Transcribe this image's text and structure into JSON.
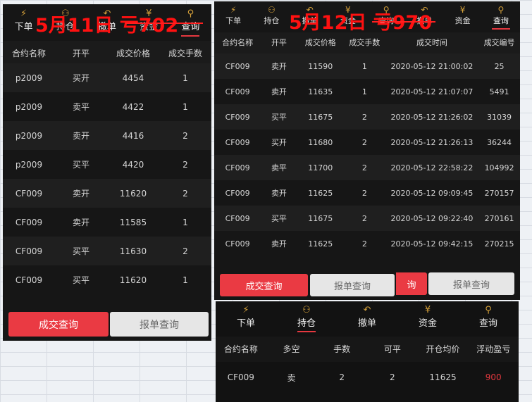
{
  "panel1": {
    "tabs": [
      {
        "icon": "lightning-icon",
        "glyph": "⚡",
        "label": "下单"
      },
      {
        "icon": "position-icon",
        "glyph": "⚇",
        "label": "持仓"
      },
      {
        "icon": "undo-arrow-icon",
        "glyph": "↶",
        "label": "撤单"
      },
      {
        "icon": "yen-coin-icon",
        "glyph": "¥",
        "label": "资金"
      },
      {
        "icon": "search-icon",
        "glyph": "⚲",
        "label": "查询"
      }
    ],
    "overlay": "5月11日 亏702",
    "headers": [
      "合约名称",
      "开平",
      "成交价格",
      "成交手数"
    ],
    "rows": [
      [
        "p2009",
        "买开",
        "4454",
        "1"
      ],
      [
        "p2009",
        "卖平",
        "4422",
        "1"
      ],
      [
        "p2009",
        "卖开",
        "4416",
        "2"
      ],
      [
        "p2009",
        "买平",
        "4420",
        "2"
      ],
      [
        "CF009",
        "卖开",
        "11620",
        "2"
      ],
      [
        "CF009",
        "卖开",
        "11585",
        "1"
      ],
      [
        "CF009",
        "买平",
        "11630",
        "2"
      ],
      [
        "CF009",
        "买平",
        "11620",
        "1"
      ]
    ],
    "buttons": {
      "trade_query": "成交查询",
      "order_query": "报单查询"
    }
  },
  "panel2": {
    "tabs": [
      {
        "icon": "lightning-icon",
        "glyph": "⚡",
        "label": "下单"
      },
      {
        "icon": "position-icon",
        "glyph": "⚇",
        "label": "持仓"
      },
      {
        "icon": "undo-arrow-icon",
        "glyph": "↶",
        "label": "撤单"
      },
      {
        "icon": "yen-coin-icon",
        "glyph": "¥",
        "label": "资金"
      },
      {
        "icon": "search-icon",
        "glyph": "⚲",
        "label": "查询"
      },
      {
        "icon": "undo-arrow-icon",
        "glyph": "↶",
        "label": "撤单"
      },
      {
        "icon": "yen-coin-icon",
        "glyph": "¥",
        "label": "资金"
      },
      {
        "icon": "search-icon",
        "glyph": "⚲",
        "label": "查询"
      }
    ],
    "overlay": "5月12日 亏970",
    "headers": [
      "合约名称",
      "开平",
      "成交价格",
      "成交手数",
      "成交时间",
      "成交编号"
    ],
    "rows": [
      [
        "CF009",
        "卖开",
        "11590",
        "1",
        "2020-05-12 21:00:02",
        "25"
      ],
      [
        "CF009",
        "卖开",
        "11635",
        "1",
        "2020-05-12 21:07:07",
        "5491"
      ],
      [
        "CF009",
        "买平",
        "11675",
        "2",
        "2020-05-12 21:26:02",
        "31039"
      ],
      [
        "CF009",
        "买开",
        "11680",
        "2",
        "2020-05-12 21:26:13",
        "36244"
      ],
      [
        "CF009",
        "卖平",
        "11700",
        "2",
        "2020-05-12 22:58:22",
        "104992"
      ],
      [
        "CF009",
        "卖开",
        "11625",
        "2",
        "2020-05-12 09:09:45",
        "270157"
      ],
      [
        "CF009",
        "买平",
        "11675",
        "2",
        "2020-05-12 09:22:40",
        "270161"
      ],
      [
        "CF009",
        "卖开",
        "11625",
        "2",
        "2020-05-12 09:42:15",
        "270215"
      ]
    ],
    "buttons": {
      "trade_query": "成交查询",
      "order_query": "报单查询",
      "trade_query_partial": "询",
      "order_query_2": "报单查询"
    }
  },
  "panel3": {
    "tabs": [
      {
        "icon": "lightning-icon",
        "glyph": "⚡",
        "label": "下单"
      },
      {
        "icon": "position-icon",
        "glyph": "⚇",
        "label": "持仓"
      },
      {
        "icon": "undo-arrow-icon",
        "glyph": "↶",
        "label": "撤单"
      },
      {
        "icon": "yen-coin-icon",
        "glyph": "¥",
        "label": "资金"
      },
      {
        "icon": "search-icon",
        "glyph": "⚲",
        "label": "查询"
      }
    ],
    "headers": [
      "合约名称",
      "多空",
      "手数",
      "可平",
      "开仓均价",
      "浮动盈亏"
    ],
    "row": [
      "CF009",
      "卖",
      "2",
      "2",
      "11625",
      "900"
    ]
  },
  "colors": {
    "accent_red": "#e5383f",
    "icon_gold": "#d6a13a",
    "overlay_red": "#ff1111",
    "panel_bg": "#161616"
  }
}
